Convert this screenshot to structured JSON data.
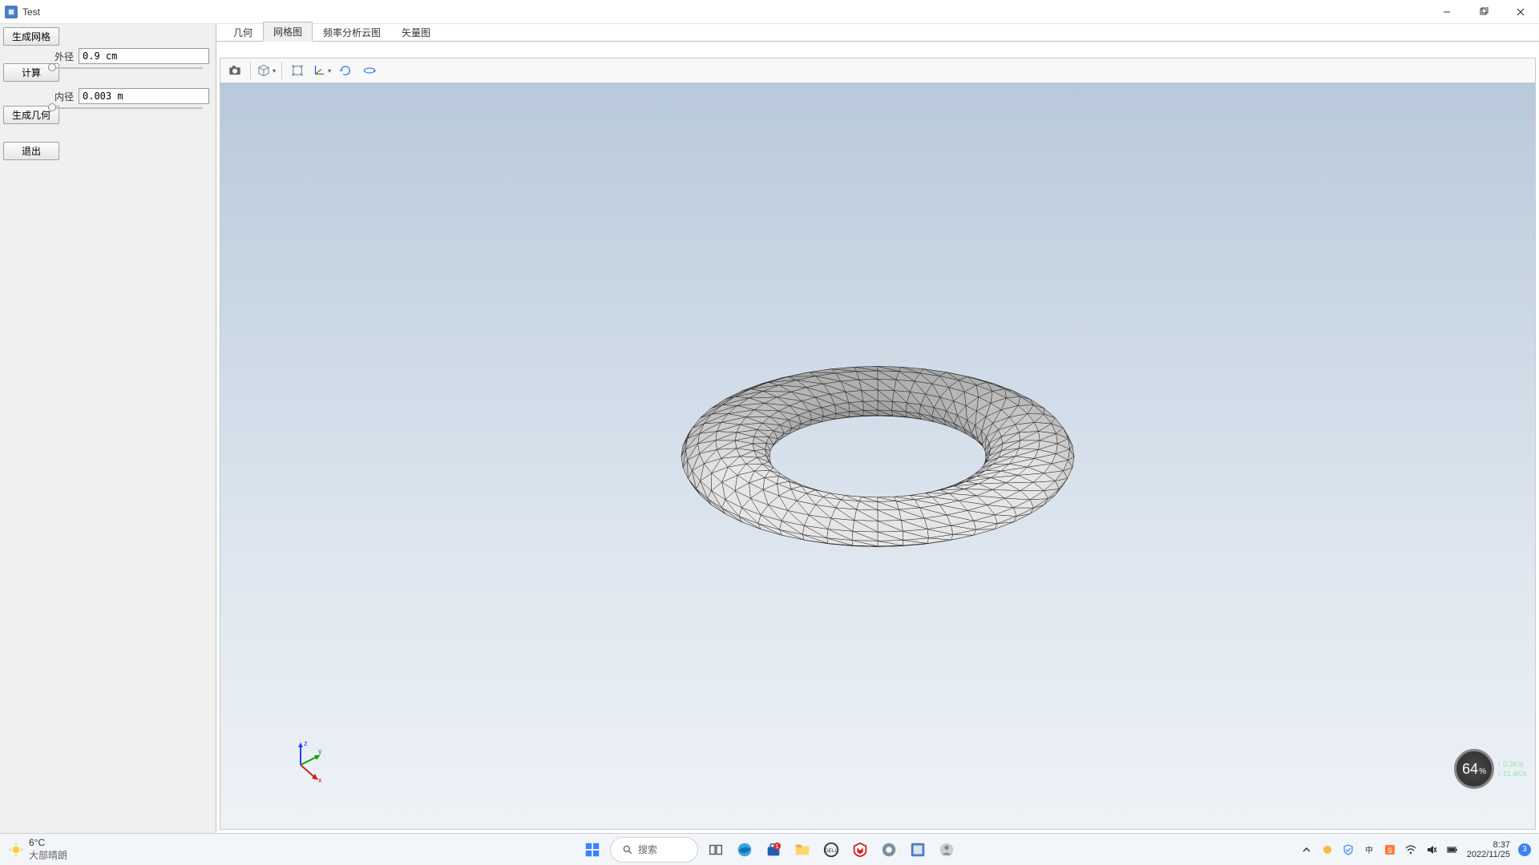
{
  "window": {
    "title": "Test"
  },
  "left_panel": {
    "generate_mesh_btn": "生成网格",
    "calculate_btn": "计算",
    "generate_geom_btn": "生成几何",
    "exit_btn": "退出",
    "outer_radius_label": "外径",
    "outer_radius_value": "0.9 cm",
    "inner_radius_label": "内径",
    "inner_radius_value": "0.003 m",
    "outer_slider_pos_pct": 0,
    "inner_slider_pos_pct": 0
  },
  "tabs": {
    "items": [
      {
        "label": "几何",
        "active": false
      },
      {
        "label": "网格图",
        "active": true
      },
      {
        "label": "频率分析云图",
        "active": false
      },
      {
        "label": "矢量图",
        "active": false
      }
    ]
  },
  "toolbar3d": {
    "items": [
      {
        "name": "screenshot-icon",
        "kind": "camera",
        "interact": true
      },
      {
        "name": "sep"
      },
      {
        "name": "transparency-icon",
        "kind": "cube",
        "interact": true,
        "arrow": true
      },
      {
        "name": "sep"
      },
      {
        "name": "zoom-extent-icon",
        "kind": "extent",
        "interact": true
      },
      {
        "name": "axis-mode-icon",
        "kind": "axes",
        "interact": true,
        "arrow": true
      },
      {
        "name": "rotate-icon",
        "kind": "rotate",
        "interact": true
      },
      {
        "name": "orbit-icon",
        "kind": "orbit",
        "interact": true
      }
    ]
  },
  "axis_labels": {
    "x": "x",
    "y": "y",
    "z": "z"
  },
  "perf_widget": {
    "percent": "64",
    "percent_suffix": "%",
    "upload": "0.2K/s",
    "download": "11.4K/s"
  },
  "taskbar": {
    "weather_temp": "6°C",
    "weather_desc": "大部晴朗",
    "search_placeholder": "搜索",
    "time": "8:37",
    "date": "2022/11/25",
    "notif_count": "3"
  }
}
